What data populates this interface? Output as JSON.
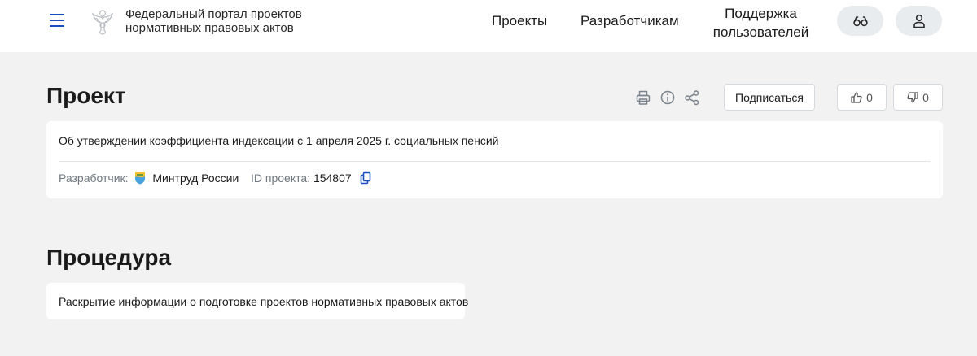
{
  "header": {
    "portal_title_line1": "Федеральный портал проектов",
    "portal_title_line2": "нормативных правовых актов",
    "nav": {
      "projects": "Проекты",
      "developers": "Разработчикам",
      "support_line1": "Поддержка",
      "support_line2": "пользователей"
    }
  },
  "project": {
    "heading": "Проект",
    "subscribe_label": "Подписаться",
    "likes": "0",
    "dislikes": "0",
    "name": "Об утверждении коэффициента индексации с 1 апреля 2025 г. социальных пенсий",
    "developer_label": "Разработчик:",
    "developer_value": "Минтруд России",
    "id_label": "ID проекта:",
    "id_value": "154807"
  },
  "procedure": {
    "heading": "Процедура",
    "text": "Раскрытие информации о подготовке проектов нормативных правовых актов"
  },
  "colors": {
    "accent": "#1a4fc4",
    "background": "#f2f2f2",
    "card": "#ffffff",
    "muted_text": "#6f7780"
  },
  "icons": [
    "menu-icon",
    "emblem-icon",
    "glasses-icon",
    "user-icon",
    "print-icon",
    "info-icon",
    "share-icon",
    "thumbs-up-icon",
    "thumbs-down-icon",
    "ministry-logo-icon",
    "copy-icon"
  ]
}
